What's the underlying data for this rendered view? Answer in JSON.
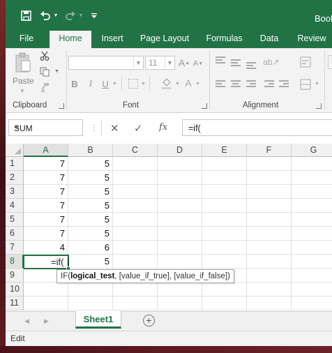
{
  "window": {
    "title": "Book"
  },
  "quick_access": {
    "icons": [
      "save-icon",
      "undo-icon",
      "redo-icon",
      "customize-icon"
    ]
  },
  "tabs": [
    {
      "label": "File"
    },
    {
      "label": "Home",
      "active": true
    },
    {
      "label": "Insert"
    },
    {
      "label": "Page Layout"
    },
    {
      "label": "Formulas"
    },
    {
      "label": "Data"
    },
    {
      "label": "Review"
    }
  ],
  "ribbon": {
    "clipboard": {
      "label": "Clipboard",
      "paste_label": "Paste"
    },
    "font": {
      "label": "Font",
      "font_name": "",
      "font_size": "11",
      "bold": "B",
      "italic": "I",
      "underline": "U"
    },
    "alignment": {
      "label": "Alignment"
    }
  },
  "formula_bar": {
    "name_box": "SUM",
    "cancel": "✕",
    "enter": "✓",
    "fx": "fx",
    "formula": "=if("
  },
  "grid": {
    "columns": [
      "A",
      "B",
      "C",
      "D",
      "E",
      "F",
      "G"
    ],
    "rows": [
      {
        "num": "1",
        "a": "7",
        "b": "5"
      },
      {
        "num": "2",
        "a": "7",
        "b": "5"
      },
      {
        "num": "3",
        "a": "7",
        "b": "5"
      },
      {
        "num": "4",
        "a": "7",
        "b": "5"
      },
      {
        "num": "5",
        "a": "7",
        "b": "5"
      },
      {
        "num": "6",
        "a": "7",
        "b": "5"
      },
      {
        "num": "7",
        "a": "4",
        "b": "6"
      },
      {
        "num": "8",
        "a": "",
        "b": "5"
      },
      {
        "num": "9",
        "a": "",
        "b": ""
      },
      {
        "num": "10",
        "a": "",
        "b": ""
      },
      {
        "num": "11",
        "a": "",
        "b": ""
      }
    ],
    "active_cell": {
      "ref": "A8",
      "value": "=if("
    }
  },
  "tooltip": {
    "prefix": "IF(",
    "bold_arg": "logical_test",
    "rest": ", [value_if_true], [value_if_false])"
  },
  "sheets": [
    {
      "label": "Sheet1",
      "active": true
    }
  ],
  "status": {
    "mode": "Edit"
  },
  "colors": {
    "accent": "#217346"
  }
}
